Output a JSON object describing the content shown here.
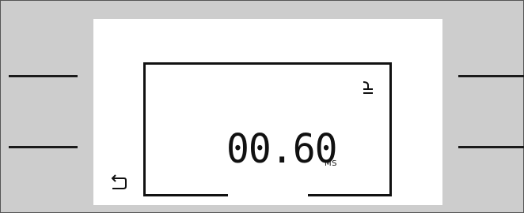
{
  "display": {
    "value": "00.60",
    "unit": "MS"
  },
  "icons": {
    "top_right": "enter-icon",
    "bottom_left": "back-icon"
  },
  "softkeys": {
    "left": [
      "softkey-left-1",
      "softkey-left-2"
    ],
    "right": [
      "softkey-right-1",
      "softkey-right-2"
    ]
  }
}
